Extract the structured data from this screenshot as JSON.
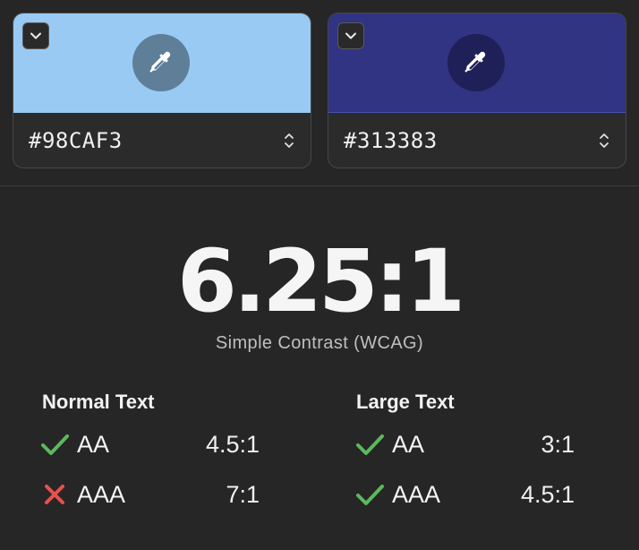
{
  "foreground": {
    "hex": "#98CAF3",
    "swatch_color": "#98CAF3",
    "picker_bg": "#5f7f99"
  },
  "background": {
    "hex": "#313383",
    "swatch_color": "#313383",
    "picker_bg": "#1f2058"
  },
  "contrast": {
    "ratio": "6.25:1",
    "label": "Simple Contrast (WCAG)"
  },
  "normal_text": {
    "title": "Normal Text",
    "rows": [
      {
        "level": "AA",
        "requirement": "4.5:1",
        "status": "pass"
      },
      {
        "level": "AAA",
        "requirement": "7:1",
        "status": "fail"
      }
    ]
  },
  "large_text": {
    "title": "Large Text",
    "rows": [
      {
        "level": "AA",
        "requirement": "3:1",
        "status": "pass"
      },
      {
        "level": "AAA",
        "requirement": "4.5:1",
        "status": "pass"
      }
    ]
  },
  "colors": {
    "pass": "#5cb85c",
    "fail": "#e5534b",
    "background": "#262626"
  },
  "icons": {
    "collapse": "chevron-down-icon",
    "picker": "eyedropper-icon",
    "stepper": "up-down-chevron-icon",
    "pass": "checkmark-icon",
    "fail": "cross-icon"
  }
}
